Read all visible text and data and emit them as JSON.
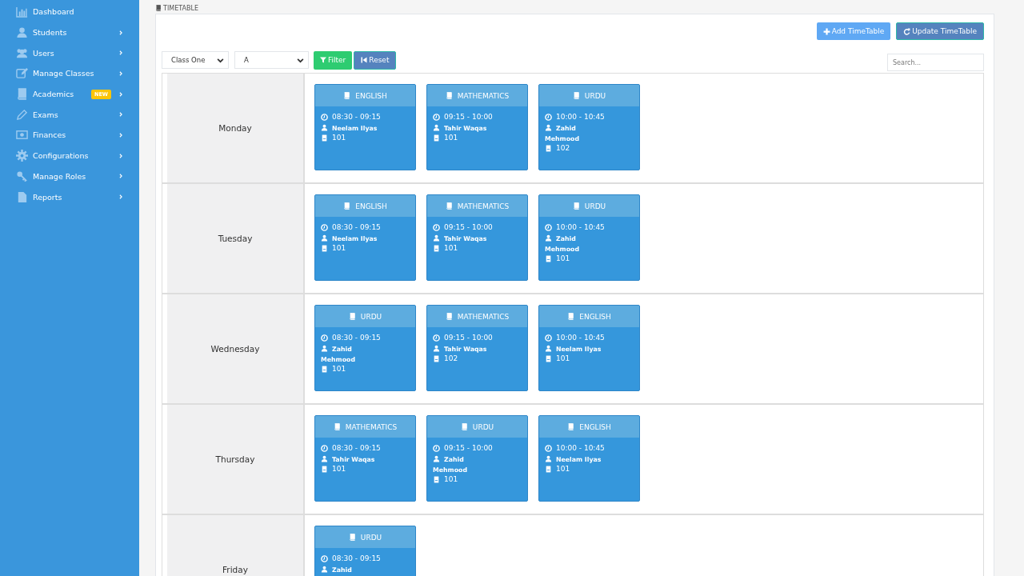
{
  "sidebar": {
    "items": [
      {
        "label": "Dashboard",
        "has_submenu": false
      },
      {
        "label": "Students",
        "has_submenu": true
      },
      {
        "label": "Users",
        "has_submenu": true
      },
      {
        "label": "Manage Classes",
        "has_submenu": true
      },
      {
        "label": "Academics",
        "has_submenu": true,
        "badge": "NEW"
      },
      {
        "label": "Exams",
        "has_submenu": true
      },
      {
        "label": "Finances",
        "has_submenu": true
      },
      {
        "label": "Configurations",
        "has_submenu": true
      },
      {
        "label": "Manage Roles",
        "has_submenu": true
      },
      {
        "label": "Reports",
        "has_submenu": true
      }
    ]
  },
  "page_title": "TIMETABLE",
  "actions": [
    {
      "label": "Add TimeTable",
      "kind": "add"
    },
    {
      "label": "Update TimeTable",
      "kind": "update"
    }
  ],
  "filters": {
    "class": "Class One",
    "section": "A",
    "buttons": [
      {
        "label": "Filter",
        "kind": "filter"
      },
      {
        "label": "Reset",
        "kind": "reset"
      }
    ]
  },
  "search": {
    "placeholder": "Search..."
  },
  "days": [
    {
      "day": "Monday",
      "periods": [
        {
          "subject": "ENGLISH",
          "time": "08:30 - 09:15",
          "teacher": "Neelam Ilyas",
          "room": "101"
        },
        {
          "subject": "MATHEMATICS",
          "time": "09:15 - 10:00",
          "teacher": "Tahir Waqas",
          "room": "101"
        },
        {
          "subject": "URDU",
          "time": "10:00 - 10:45",
          "teacher": "Zahid Mehmood",
          "room": "102"
        }
      ]
    },
    {
      "day": "Tuesday",
      "periods": [
        {
          "subject": "ENGLISH",
          "time": "08:30 - 09:15",
          "teacher": "Neelam Ilyas",
          "room": "101"
        },
        {
          "subject": "MATHEMATICS",
          "time": "09:15 - 10:00",
          "teacher": "Tahir Waqas",
          "room": "101"
        },
        {
          "subject": "URDU",
          "time": "10:00 - 10:45",
          "teacher": "Zahid Mehmood",
          "room": "101"
        }
      ]
    },
    {
      "day": "Wednesday",
      "periods": [
        {
          "subject": "URDU",
          "time": "08:30 - 09:15",
          "teacher": "Zahid Mehmood",
          "room": "101"
        },
        {
          "subject": "MATHEMATICS",
          "time": "09:15 - 10:00",
          "teacher": "Tahir Waqas",
          "room": "102"
        },
        {
          "subject": "ENGLISH",
          "time": "10:00 - 10:45",
          "teacher": "Neelam Ilyas",
          "room": "101"
        }
      ]
    },
    {
      "day": "Thursday",
      "periods": [
        {
          "subject": "MATHEMATICS",
          "time": "08:30 - 09:15",
          "teacher": "Tahir Waqas",
          "room": "101"
        },
        {
          "subject": "URDU",
          "time": "09:15 - 10:00",
          "teacher": "Zahid Mehmood",
          "room": "101"
        },
        {
          "subject": "ENGLISH",
          "time": "10:00 - 10:45",
          "teacher": "Neelam Ilyas",
          "room": "101"
        }
      ]
    },
    {
      "day": "Friday",
      "periods": [
        {
          "subject": "URDU",
          "time": "08:30 - 09:15",
          "teacher": "Zahid"
        }
      ]
    }
  ]
}
